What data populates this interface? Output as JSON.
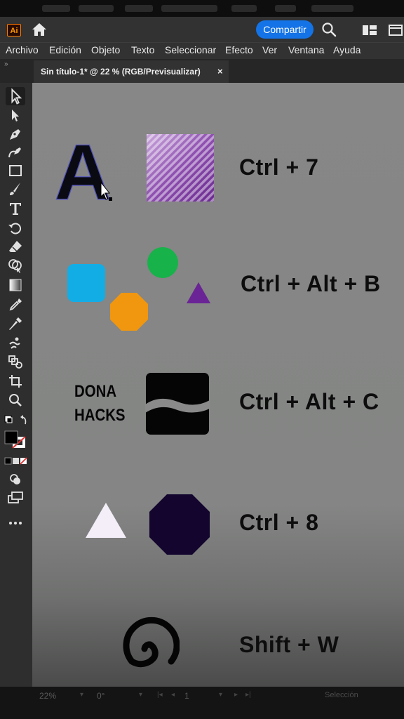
{
  "app": {
    "logo": "Ai",
    "share_label": "Compartir"
  },
  "menu": [
    "Archivo",
    "Edición",
    "Objeto",
    "Texto",
    "Seleccionar",
    "Efecto",
    "Ver",
    "Ventana",
    "Ayuda"
  ],
  "document_tab": {
    "title": "Sin título-1* @ 22 % (RGB/Previsualizar)",
    "close": "×"
  },
  "toolbar_icons": [
    "selection-tool-icon",
    "direct-selection-tool-icon",
    "pen-tool-icon",
    "curvature-tool-icon",
    "rectangle-tool-icon",
    "paintbrush-tool-icon",
    "type-tool-icon",
    "rotate-tool-icon",
    "eraser-tool-icon",
    "shape-builder-tool-icon",
    "gradient-tool-icon",
    "eyedropper-tool-icon",
    "blend-tool-icon",
    "puppet-warp-tool-icon",
    "artboard-tool-icon",
    "zoom-tool-icon",
    "fill-stroke-swatch-icon",
    "draw-mode-icon",
    "screen-mode-icon",
    "more-tools-icon"
  ],
  "canvas": {
    "letter_a": "A",
    "shortcuts": {
      "row1": "Ctrl + 7",
      "row2": "Ctrl + Alt + B",
      "row3": "Ctrl + Alt + C",
      "row4": "Ctrl + 8",
      "row5": "Shift + W"
    },
    "brand_line1": "DONA",
    "brand_line2": "HACKS",
    "colors": {
      "blue_square": "#13ade6",
      "green_circle": "#17b24a",
      "orange_octagon": "#f0960f",
      "purple_triangle": "#6b2496",
      "dark_octagon": "#13052e",
      "white_triangle": "#f3eef8"
    }
  },
  "status_bar": {
    "zoom": "22%",
    "rotation": "0°",
    "page": "1",
    "status": "Selección"
  }
}
